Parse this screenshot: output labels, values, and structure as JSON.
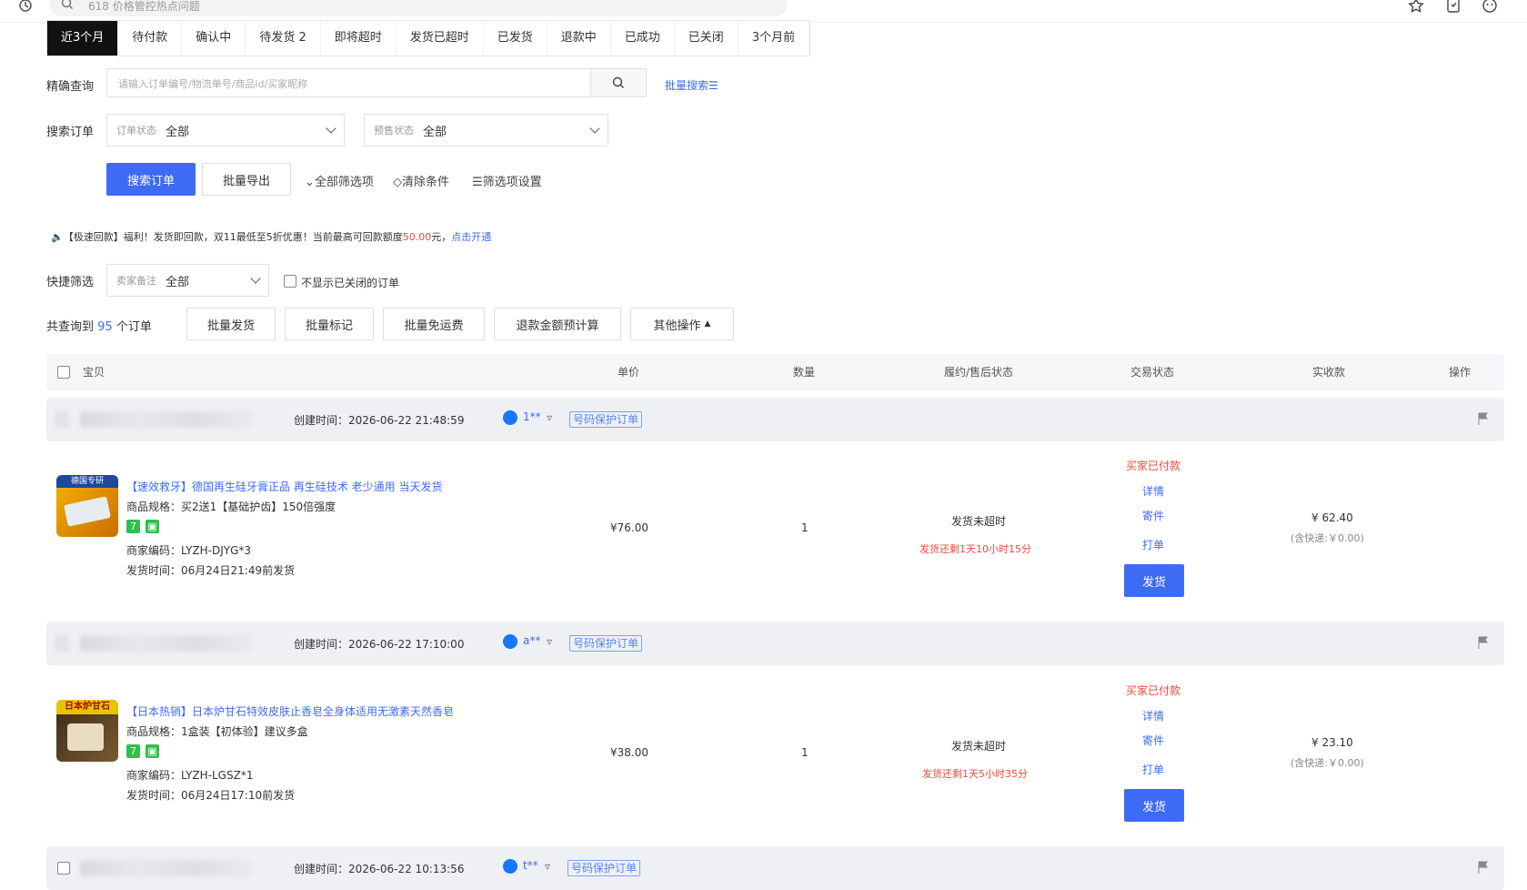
{
  "browser": {
    "search_placeholder": "618 价格管控热点问题"
  },
  "tabs": [
    {
      "label": "近3个月",
      "active": true
    },
    {
      "label": "待付款"
    },
    {
      "label": "确认中"
    },
    {
      "label": "待发货 2"
    },
    {
      "label": "即将超时"
    },
    {
      "label": "发货已超时"
    },
    {
      "label": "已发货"
    },
    {
      "label": "退款中"
    },
    {
      "label": "已成功"
    },
    {
      "label": "已关闭"
    },
    {
      "label": "3个月前"
    }
  ],
  "filters": {
    "exact_label": "精确查询",
    "exact_placeholder": "请输入订单编号/物流单号/商品id/买家昵称",
    "batch_search": "批量搜索",
    "search_label": "搜索订单",
    "order_status_label": "订单状态",
    "order_status_value": "全部",
    "presale_label": "预售状态",
    "presale_value": "全部",
    "search_button": "搜索订单",
    "export_button": "批量导出",
    "all_filters": "全部筛选项",
    "clear": "清除条件",
    "settings": "筛选项设置"
  },
  "notice": {
    "prefix": "【极速回款】福利！发货即回款，双11最低至5折优惠！当前最高可回款额度",
    "amount": "50.00",
    "suffix": "元，",
    "link": "点击开通"
  },
  "quick": {
    "label": "快捷筛选",
    "remark_label": "卖家备注",
    "remark_value": "全部",
    "hide_closed": "不显示已关闭的订单"
  },
  "summary": {
    "prefix": "共查询到",
    "count": "95",
    "suffix": "个订单"
  },
  "actions": [
    "批量发货",
    "批量标记",
    "批量免运费",
    "退款金额预计算",
    "其他操作"
  ],
  "table_headers": {
    "item": "宝贝",
    "price": "单价",
    "qty": "数量",
    "after_sale": "履约/售后状态",
    "trade_status": "交易状态",
    "paid": "实收款",
    "ops": "操作"
  },
  "orders": [
    {
      "created": "创建时间：2026-06-22 21:48:59",
      "buyer": "1**",
      "tag": "号码保护订单",
      "thumb_text": "德国专研",
      "title": "【速效救牙】德国再生硅牙膏正品 再生硅技术 老少通用 当天发货",
      "spec": "商品规格：买2送1【基础护齿】150倍强度",
      "code": "商家编码：LYZH-DJYG*3",
      "ship_by": "发货时间：06月24日21:49前发货",
      "price": "¥76.00",
      "qty": "1",
      "status": "发货未超时",
      "remaining": "发货还剩1天10小时15分",
      "trade": "买家已付款",
      "detail": "详情",
      "send": "寄件",
      "print": "打单",
      "ship_btn": "发货",
      "paid": "¥ 62.40",
      "shipping": "(含快递:￥0.00)"
    },
    {
      "created": "创建时间：2026-06-22 17:10:00",
      "buyer": "a**",
      "tag": "号码保护订单",
      "thumb_text": "日本炉甘石",
      "title": "【日本热销】日本炉甘石特效皮肤止香皂全身体适用无激素天然香皂",
      "spec": "商品规格：1盒装【初体验】建议多盒",
      "code": "商家编码：LYZH-LGSZ*1",
      "ship_by": "发货时间：06月24日17:10前发货",
      "price": "¥38.00",
      "qty": "1",
      "status": "发货未超时",
      "remaining": "发货还剩1天5小时35分",
      "trade": "买家已付款",
      "detail": "详情",
      "send": "寄件",
      "print": "打单",
      "ship_btn": "发货",
      "paid": "¥ 23.10",
      "shipping": "(含快递:￥0.00)"
    },
    {
      "created": "创建时间：2026-06-22 10:13:56",
      "buyer": "t**",
      "tag": "号码保护订单"
    }
  ]
}
